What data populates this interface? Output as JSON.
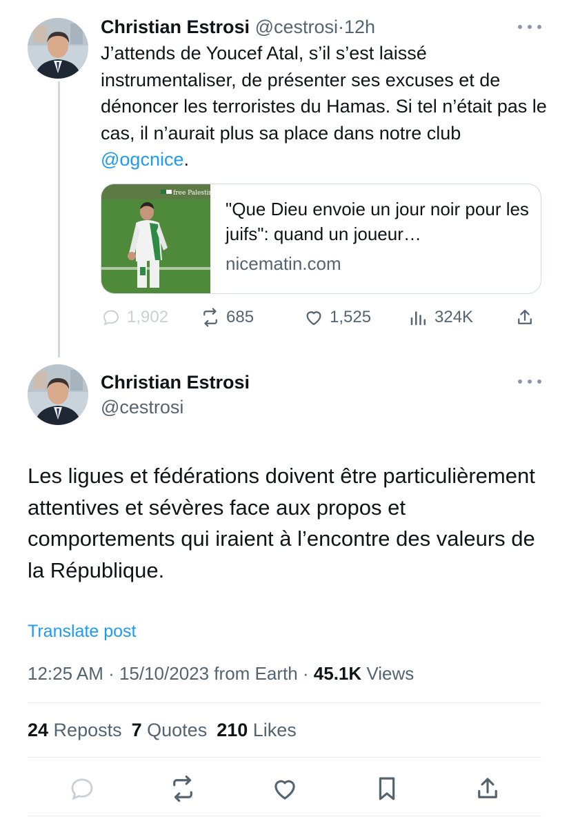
{
  "tweet1": {
    "name": "Christian Estrosi",
    "handle": "@cestrosi",
    "separator": "·",
    "time": "12h",
    "text_before_mention": "J’attends de Youcef Atal, s’il s’est laissé instrumentaliser, de présenter ses excuses et de dénoncer les terroristes du Hamas. Si tel n’était pas le cas, il n’aurait plus sa place dans notre club ",
    "mention": "@ogcnice",
    "text_after_mention": ".",
    "card": {
      "image_overlay_text": "free Palestine",
      "title": "\"Que Dieu envoie un jour noir pour les juifs\": quand un joueur…",
      "domain": "nicematin.com"
    },
    "actions": {
      "replies": "1,902",
      "reposts": "685",
      "likes": "1,525",
      "views": "324K"
    }
  },
  "tweet2": {
    "name": "Christian Estrosi",
    "handle": "@cestrosi",
    "text": "Les ligues et fédérations doivent être particulièrement attentives et sévères face aux propos et comportements qui iraient à l’encontre des valeurs de la République.",
    "translate_label": "Translate post",
    "meta": {
      "time_date": "12:25 AM · 15/10/2023 from Earth · ",
      "views_count": "45.1K",
      "views_label": " Views"
    },
    "stats": {
      "reposts_count": "24",
      "reposts_label": " Reposts",
      "quotes_count": "7",
      "quotes_label": " Quotes",
      "likes_count": "210",
      "likes_label": " Likes"
    }
  },
  "colors": {
    "accent": "#1d9bf0",
    "secondary_text": "#536471",
    "border": "#cfd9de"
  },
  "icons": [
    "more-icon",
    "reply-icon",
    "repost-icon",
    "like-icon",
    "views-icon",
    "share-icon",
    "bookmark-icon"
  ]
}
